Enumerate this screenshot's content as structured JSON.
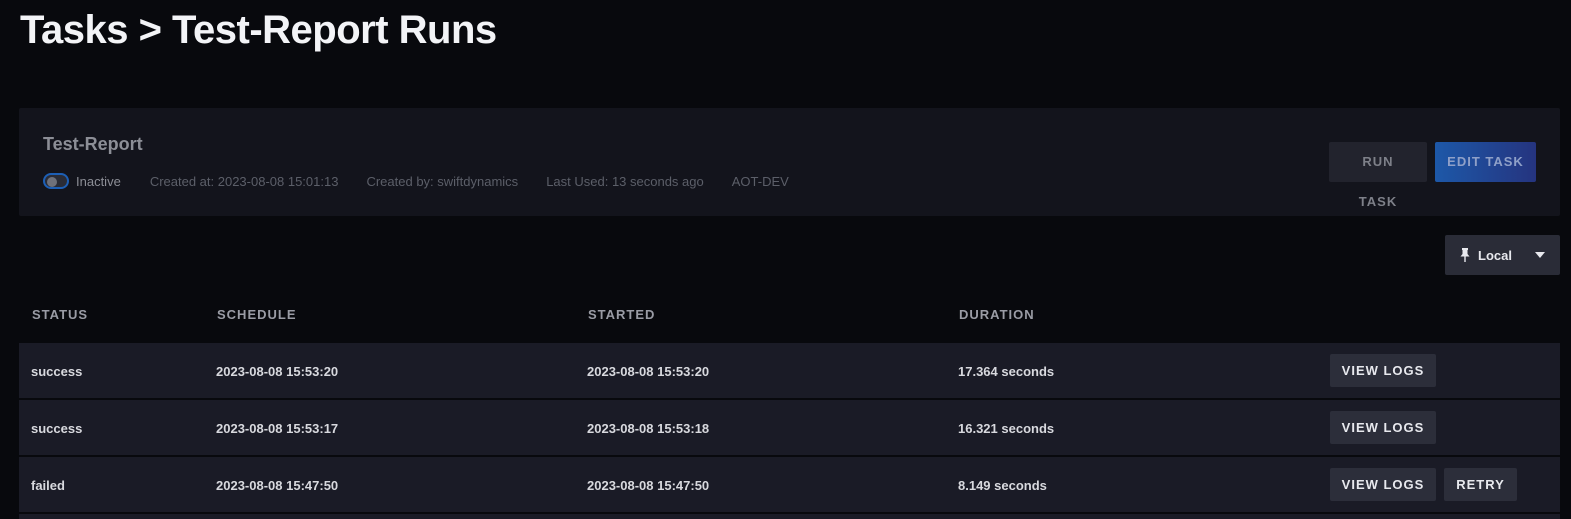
{
  "page": {
    "title": "Tasks > Test-Report Runs"
  },
  "task": {
    "name": "Test-Report",
    "status_toggle_label": "Inactive",
    "status_toggle_on": false,
    "created_at": "Created at: 2023-08-08 15:01:13",
    "created_by": "Created by: swiftdynamics",
    "last_used": "Last Used: 13 seconds ago",
    "environment": "AOT-DEV",
    "run_task_label": "RUN TASK",
    "edit_task_label": "EDIT TASK"
  },
  "runner_select": {
    "selected": "Local",
    "icon": "pin-icon"
  },
  "table": {
    "headers": [
      "STATUS",
      "SCHEDULE",
      "STARTED",
      "DURATION"
    ],
    "rows": [
      {
        "status": "success",
        "schedule": "2023-08-08 15:53:20",
        "started": "2023-08-08 15:53:20",
        "duration": "17.364 seconds",
        "view_logs": "VIEW LOGS"
      },
      {
        "status": "success",
        "schedule": "2023-08-08 15:53:17",
        "started": "2023-08-08 15:53:18",
        "duration": "16.321 seconds",
        "view_logs": "VIEW LOGS"
      },
      {
        "status": "failed",
        "schedule": "2023-08-08 15:47:50",
        "started": "2023-08-08 15:47:50",
        "duration": "8.149 seconds",
        "view_logs": "VIEW LOGS",
        "retry": "RETRY"
      }
    ]
  },
  "colors": {
    "background": "#08090d",
    "card": "#13141c",
    "row": "#1a1b26",
    "accent_blue": "#1d58a8"
  }
}
